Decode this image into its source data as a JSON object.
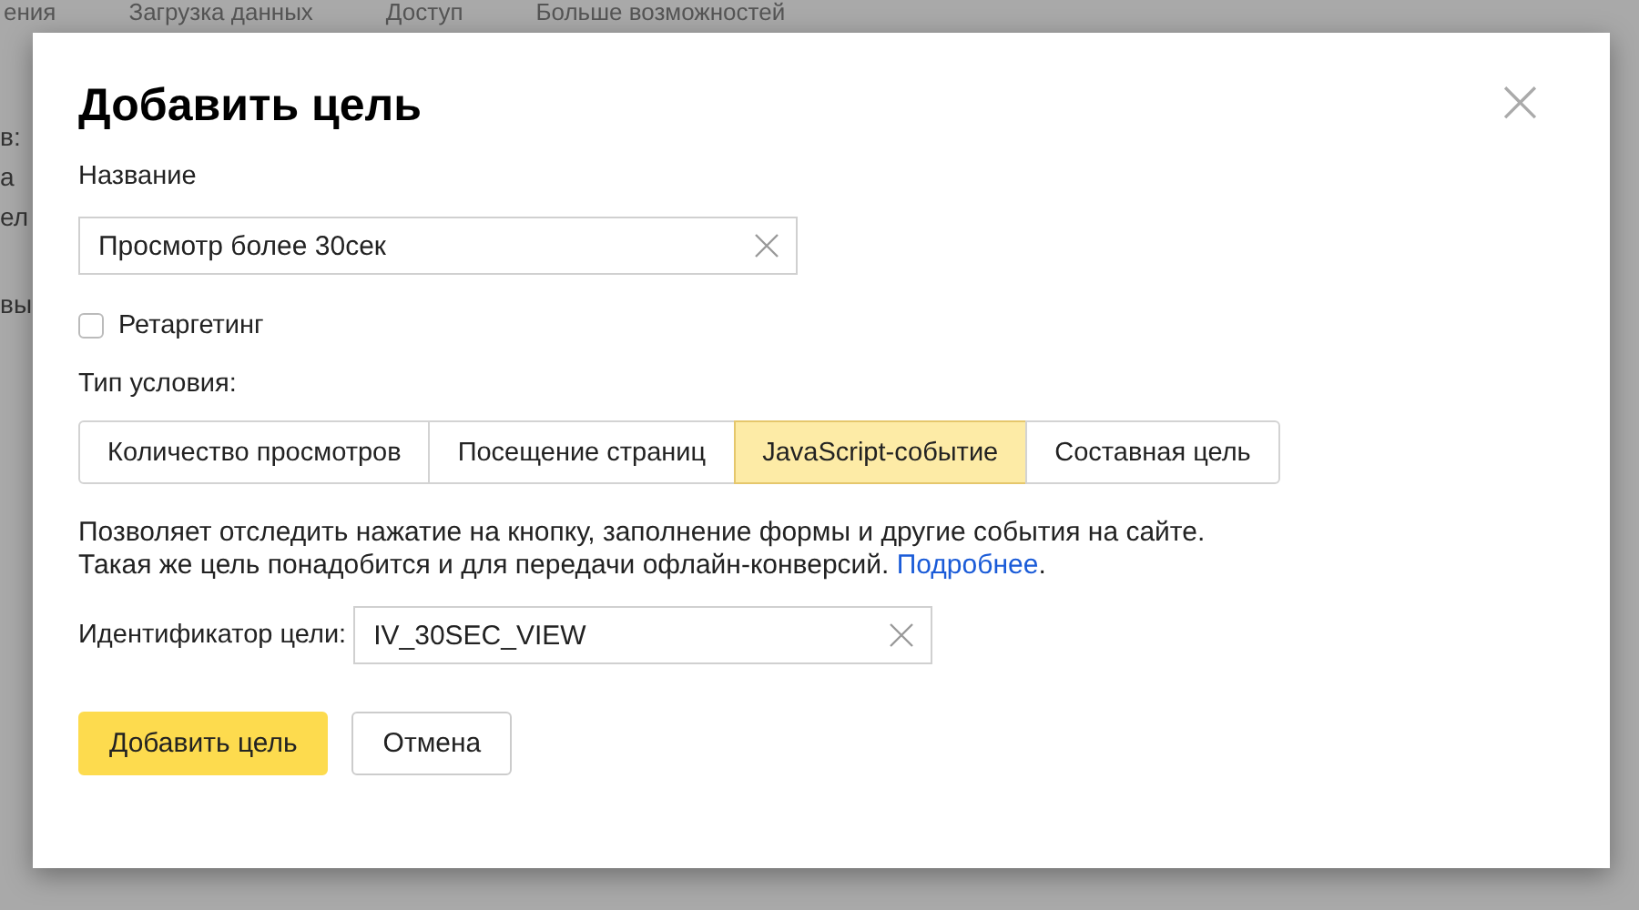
{
  "background_page": {
    "nav_tabs": [
      "ения",
      "Загрузка данных",
      "Доступ",
      "Больше возможностей"
    ],
    "side_texts": [
      "в:",
      "а",
      "ел",
      "вы"
    ]
  },
  "dialog": {
    "title": "Добавить цель",
    "close_icon": "×",
    "name_label": "Название",
    "name_field": {
      "value": "Просмотр более 30сек"
    },
    "retargeting": {
      "label": "Ретаргетинг",
      "checked": false
    },
    "condition_label": "Тип условия:",
    "condition_types": [
      {
        "label": "Количество просмотров",
        "selected": false
      },
      {
        "label": "Посещение страниц",
        "selected": false
      },
      {
        "label": "JavaScript-событие",
        "selected": true
      },
      {
        "label": "Составная цель",
        "selected": false
      }
    ],
    "description": "Позволяет отследить нажатие на кнопку, заполнение формы и другие события на сайте. Такая же цель понадобится и для передачи офлайн-конверсий.",
    "more_link": "Подробнее",
    "description_end": ".",
    "goal_id_label": "Идентификатор цели:",
    "goal_id_field": {
      "value": "IV_30SEC_VIEW"
    },
    "buttons": [
      {
        "label": "Добавить цель",
        "kind": "primary"
      },
      {
        "label": "Отмена",
        "kind": "secondary"
      }
    ]
  }
}
